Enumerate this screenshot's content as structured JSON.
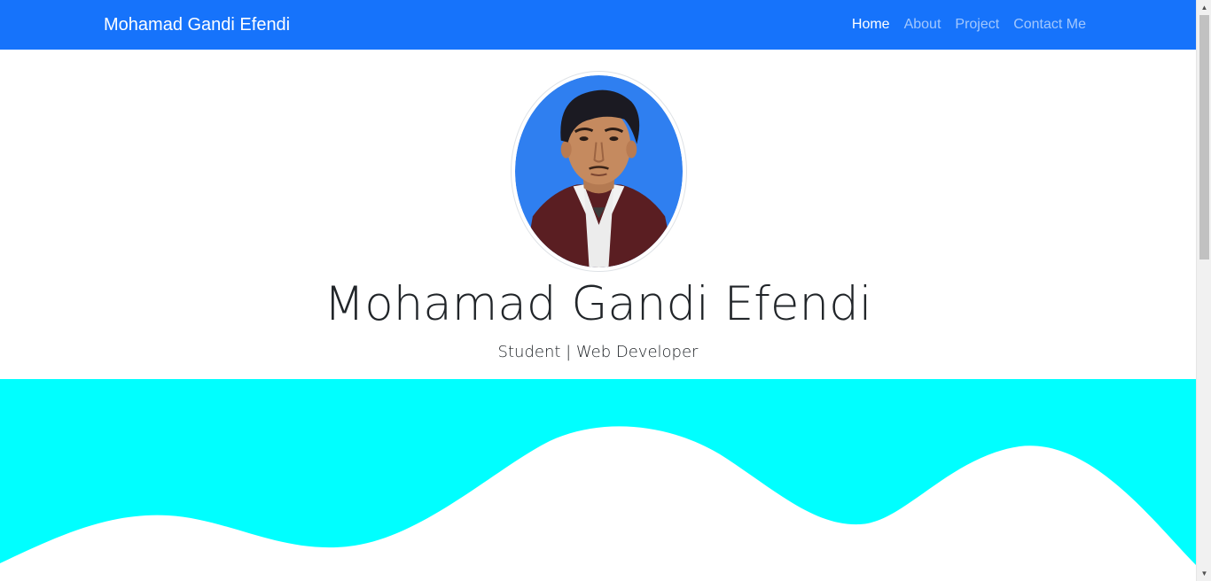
{
  "navbar": {
    "brand": "Mohamad Gandi Efendi",
    "links": [
      {
        "label": "Home",
        "active": true
      },
      {
        "label": "About",
        "active": false
      },
      {
        "label": "Project",
        "active": false
      },
      {
        "label": "Contact Me",
        "active": false
      }
    ]
  },
  "hero": {
    "name": "Mohamad Gandi Efendi",
    "subtitle": "Student | Web Developer",
    "avatar": "profile-photo"
  },
  "colors": {
    "navbar_bg": "#1673fb",
    "wave_bg": "#00ffff",
    "wave_fg": "#ffffff"
  },
  "scrollbar": {
    "up_icon": "triangle-up-icon",
    "down_icon": "triangle-down-icon"
  }
}
